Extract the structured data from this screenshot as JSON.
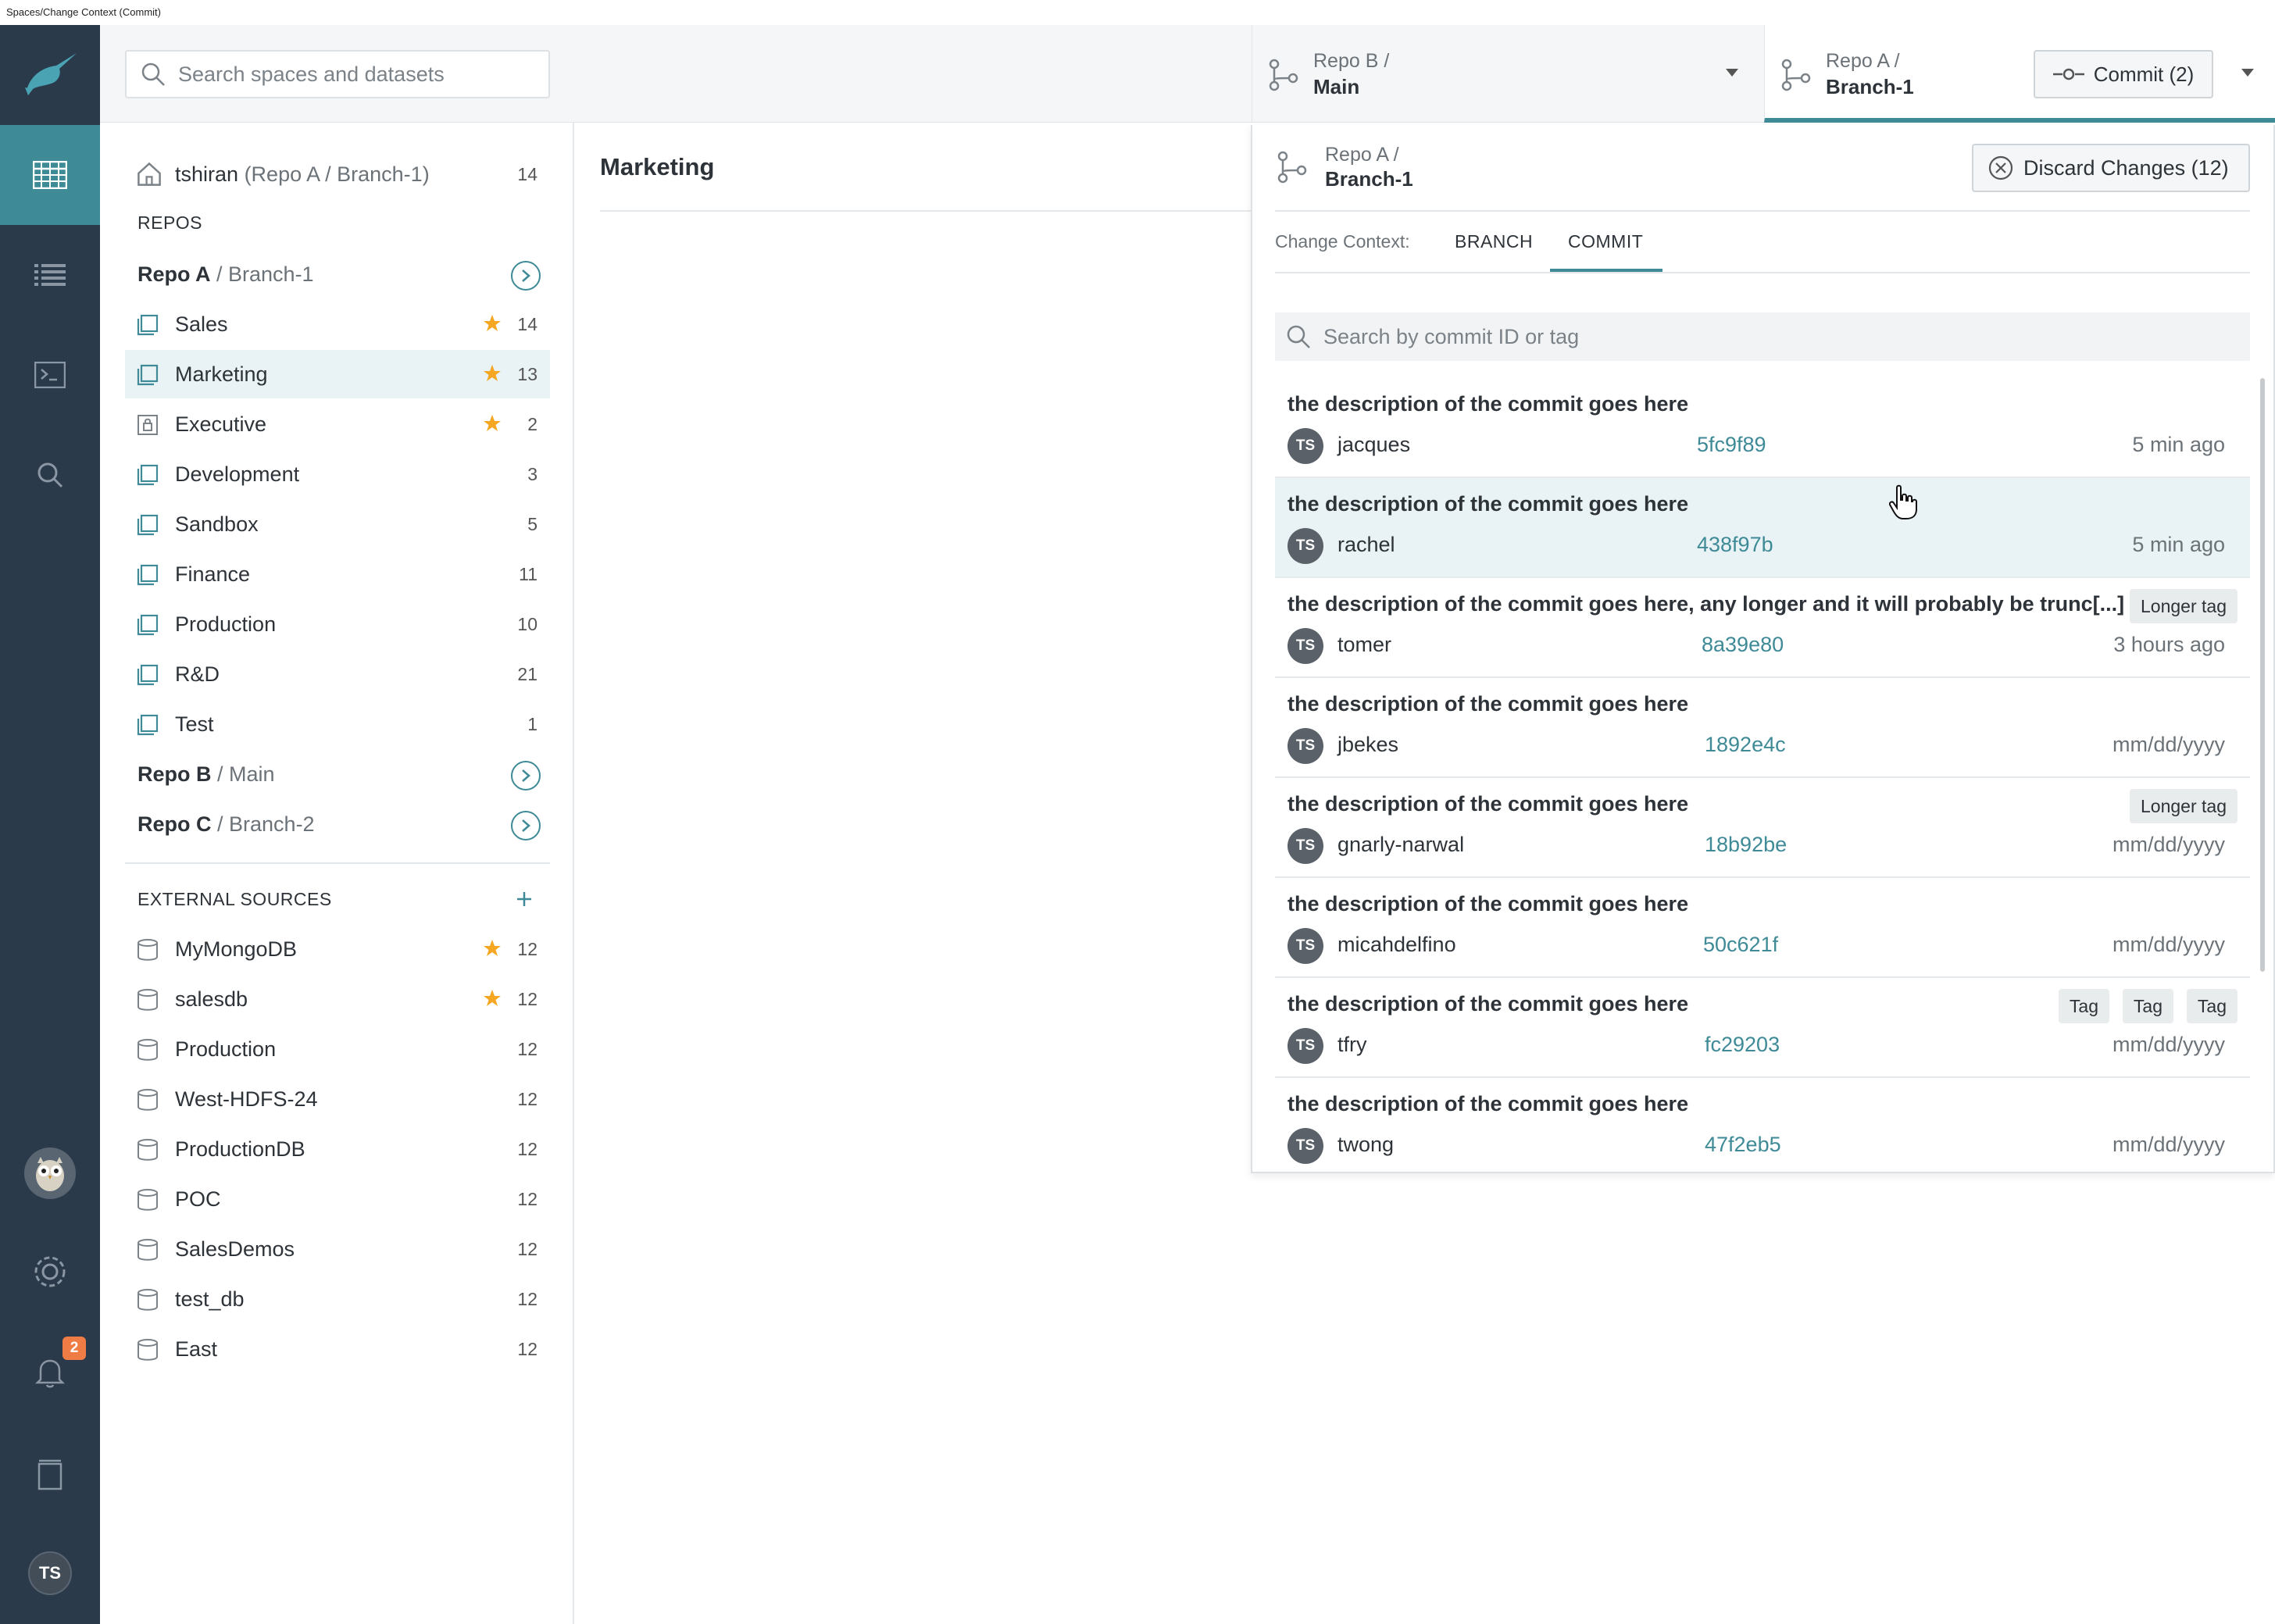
{
  "window_title": "Spaces/Change Context (Commit)",
  "search": {
    "placeholder": "Search spaces and datasets"
  },
  "context_b": {
    "repo": "Repo B /",
    "branch": "Main"
  },
  "context_a": {
    "repo": "Repo A /",
    "branch": "Branch-1"
  },
  "commit_button": "Commit (2)",
  "notifications_count": "2",
  "user_initials": "TS",
  "home": {
    "user": "tshiran",
    "context": "(Repo A / Branch-1)",
    "count": "14"
  },
  "sections": {
    "repos": "REPOS",
    "external": "EXTERNAL SOURCES"
  },
  "repos": [
    {
      "name": "Repo A",
      "sep": " / ",
      "branch": "Branch-1"
    },
    {
      "name": "Repo B",
      "sep": " / ",
      "branch": "Main"
    },
    {
      "name": "Repo C",
      "sep": " / ",
      "branch": "Branch-2"
    }
  ],
  "spaces": [
    {
      "label": "Sales",
      "count": "14",
      "starred": true
    },
    {
      "label": "Marketing",
      "count": "13",
      "starred": true
    },
    {
      "label": "Executive",
      "count": "2",
      "starred": true
    },
    {
      "label": "Development",
      "count": "3",
      "starred": false
    },
    {
      "label": "Sandbox",
      "count": "5",
      "starred": false
    },
    {
      "label": "Finance",
      "count": "11",
      "starred": false
    },
    {
      "label": "Production",
      "count": "10",
      "starred": false
    },
    {
      "label": "R&D",
      "count": "21",
      "starred": false
    },
    {
      "label": "Test",
      "count": "1",
      "starred": false
    }
  ],
  "external_sources": [
    {
      "label": "MyMongoDB",
      "count": "12",
      "starred": true
    },
    {
      "label": "salesdb",
      "count": "12",
      "starred": true
    },
    {
      "label": "Production",
      "count": "12",
      "starred": false
    },
    {
      "label": "West-HDFS-24",
      "count": "12",
      "starred": false
    },
    {
      "label": "ProductionDB",
      "count": "12",
      "starred": false
    },
    {
      "label": "POC",
      "count": "12",
      "starred": false
    },
    {
      "label": "SalesDemos",
      "count": "12",
      "starred": false
    },
    {
      "label": "test_db",
      "count": "12",
      "starred": false
    },
    {
      "label": "East",
      "count": "12",
      "starred": false
    }
  ],
  "main": {
    "title": "Marketing"
  },
  "panel": {
    "repo": "Repo A /",
    "branch": "Branch-1",
    "discard_label": "Discard Changes (12)",
    "change_context_label": "Change Context:",
    "tabs": [
      "BRANCH",
      "COMMIT"
    ],
    "search_placeholder": "Search by commit ID or tag"
  },
  "commits": [
    {
      "desc": "the description of the commit goes here",
      "initials": "TS",
      "user": "jacques",
      "hash": "5fc9f89",
      "time": "5 min ago",
      "tags": []
    },
    {
      "desc": "the description of the commit goes here",
      "initials": "TS",
      "user": "rachel",
      "hash": "438f97b",
      "time": "5 min ago",
      "tags": []
    },
    {
      "desc": "the description of the commit goes here, any longer and it will probably be trunc[...]",
      "initials": "TS",
      "user": "tomer",
      "hash": "8a39e80",
      "time": "3 hours ago",
      "tags": [
        "Longer tag"
      ]
    },
    {
      "desc": "the description of the commit goes here",
      "initials": "TS",
      "user": "jbekes",
      "hash": "1892e4c",
      "time": "mm/dd/yyyy",
      "tags": []
    },
    {
      "desc": "the description of the commit goes here",
      "initials": "TS",
      "user": "gnarly-narwal",
      "hash": "18b92be",
      "time": "mm/dd/yyyy",
      "tags": [
        "Longer tag"
      ]
    },
    {
      "desc": "the description of the commit goes here",
      "initials": "TS",
      "user": "micahdelfino",
      "hash": "50c621f",
      "time": "mm/dd/yyyy",
      "tags": []
    },
    {
      "desc": "the description of the commit goes here",
      "initials": "TS",
      "user": "tfry",
      "hash": "fc29203",
      "time": "mm/dd/yyyy",
      "tags": [
        "Tag",
        "Tag",
        "Tag"
      ]
    },
    {
      "desc": "the description of the commit goes here",
      "initials": "TS",
      "user": "twong",
      "hash": "47f2eb5",
      "time": "mm/dd/yyyy",
      "tags": []
    }
  ],
  "colors": {
    "rail": "#2b3a4a",
    "accent": "#3e8a97",
    "star": "#f5a623",
    "badge": "#f07c45"
  }
}
